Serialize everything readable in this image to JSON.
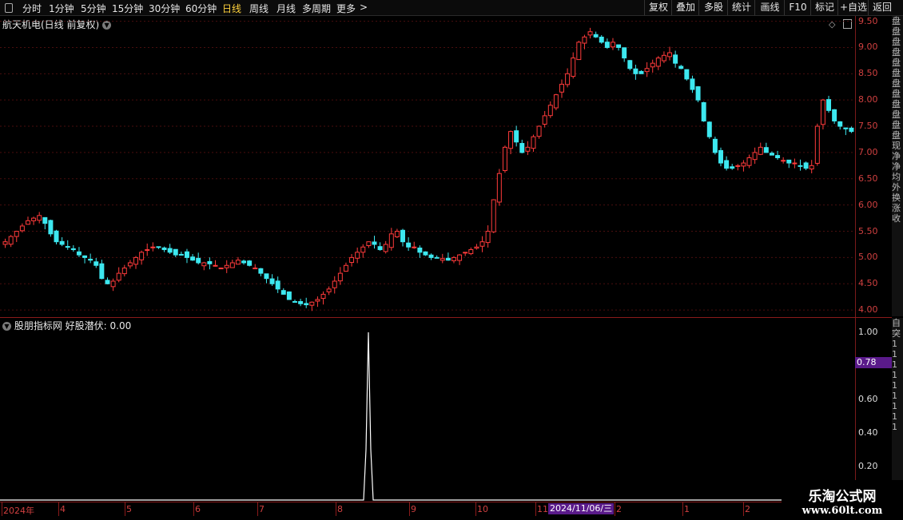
{
  "toolbar": {
    "periods": [
      {
        "label": "分时",
        "active": false
      },
      {
        "label": "1分钟",
        "active": false
      },
      {
        "label": "5分钟",
        "active": false
      },
      {
        "label": "15分钟",
        "active": false
      },
      {
        "label": "30分钟",
        "active": false
      },
      {
        "label": "60分钟",
        "active": false
      },
      {
        "label": "日线",
        "active": true
      },
      {
        "label": "周线",
        "active": false
      },
      {
        "label": "月线",
        "active": false
      },
      {
        "label": "多周期",
        "active": false
      },
      {
        "label": "更多",
        "active": false
      }
    ],
    "more_chevron": ">",
    "right_buttons": [
      "复权",
      "叠加",
      "多股",
      "统计",
      "画线",
      "F10",
      "标记",
      "+自选",
      "返回"
    ]
  },
  "main_panel": {
    "title": "航天机电(日线 前复权)",
    "price_ticks": [
      "9.50",
      "9.00",
      "8.50",
      "8.00",
      "7.50",
      "7.00",
      "6.50",
      "6.00",
      "5.50",
      "5.00",
      "4.50",
      "4.00"
    ],
    "price_range": [
      3.85,
      9.6
    ]
  },
  "indicator_panel": {
    "title": "股朋指标网 好股潜伏: 0.00",
    "value_ticks": [
      "1.00",
      "0.60",
      "0.40",
      "0.20"
    ],
    "highlight_value": "0.78",
    "spike_value": 1.0
  },
  "date_axis": {
    "labels": [
      "2024年",
      "4",
      "5",
      "6",
      "7",
      "8",
      "9",
      "10",
      "11",
      "2",
      "1",
      "2"
    ],
    "cursor_date": "2024/11/06/三"
  },
  "right_strip_top": "盘 盘 盘 盘 盘 盘 盘 盘 盘 盘 盘 盘 现 净 净 均 外 换 涨 收",
  "right_strip_bottom": "自 突 1 1 1 1 1 1 1 1 1",
  "watermark": {
    "line1": "乐淘公式网",
    "line2": "www.60lt.com"
  },
  "colors": {
    "up": "#ff3b3b",
    "down": "#3de8f0",
    "axis": "#cc3333",
    "grid": "#5a1010",
    "highlight": "#5a1a8a"
  },
  "chart_data": {
    "type": "candlestick",
    "title": "航天机电(日线 前复权)",
    "ylim": [
      3.85,
      9.6
    ],
    "x_labels": [
      "2024年",
      "4",
      "5",
      "6",
      "7",
      "8",
      "9",
      "10",
      "11",
      "12",
      "1",
      "2"
    ],
    "close_series": [
      5.3,
      5.4,
      5.5,
      5.6,
      5.7,
      5.75,
      5.8,
      5.65,
      5.45,
      5.3,
      5.25,
      5.2,
      5.15,
      5.05,
      5.0,
      4.95,
      4.85,
      4.6,
      4.5,
      4.55,
      4.7,
      4.8,
      4.9,
      5.0,
      5.1,
      5.15,
      5.2,
      5.2,
      5.15,
      5.1,
      5.05,
      5.05,
      5.0,
      4.95,
      4.9,
      4.9,
      4.88,
      4.85,
      4.8,
      4.85,
      4.9,
      4.95,
      4.9,
      4.85,
      4.8,
      4.7,
      4.6,
      4.5,
      4.4,
      4.3,
      4.2,
      4.15,
      4.12,
      4.1,
      4.15,
      4.2,
      4.3,
      4.4,
      4.55,
      4.7,
      4.85,
      5.0,
      5.1,
      5.2,
      5.3,
      5.25,
      5.15,
      5.25,
      5.45,
      5.5,
      5.3,
      5.2,
      5.2,
      5.1,
      5.05,
      5.0,
      5.0,
      4.98,
      4.95,
      5.0,
      5.05,
      5.1,
      5.15,
      5.2,
      5.3,
      5.5,
      6.1,
      6.6,
      7.1,
      7.4,
      7.2,
      7.0,
      7.1,
      7.3,
      7.5,
      7.7,
      7.9,
      8.1,
      8.3,
      8.5,
      8.8,
      9.1,
      9.2,
      9.3,
      9.2,
      9.1,
      9.0,
      9.1,
      9.0,
      8.8,
      8.6,
      8.5,
      8.5,
      8.6,
      8.7,
      8.8,
      8.85,
      8.9,
      8.7,
      8.6,
      8.4,
      8.2,
      8.0,
      7.6,
      7.3,
      7.0,
      6.8,
      6.7,
      6.7,
      6.75,
      6.8,
      6.9,
      7.0,
      7.1,
      7.0,
      6.95,
      6.9,
      6.85,
      6.8,
      6.8,
      6.75,
      6.7,
      6.75,
      7.5,
      8.0,
      7.8,
      7.6,
      7.5,
      7.45,
      7.4
    ]
  }
}
